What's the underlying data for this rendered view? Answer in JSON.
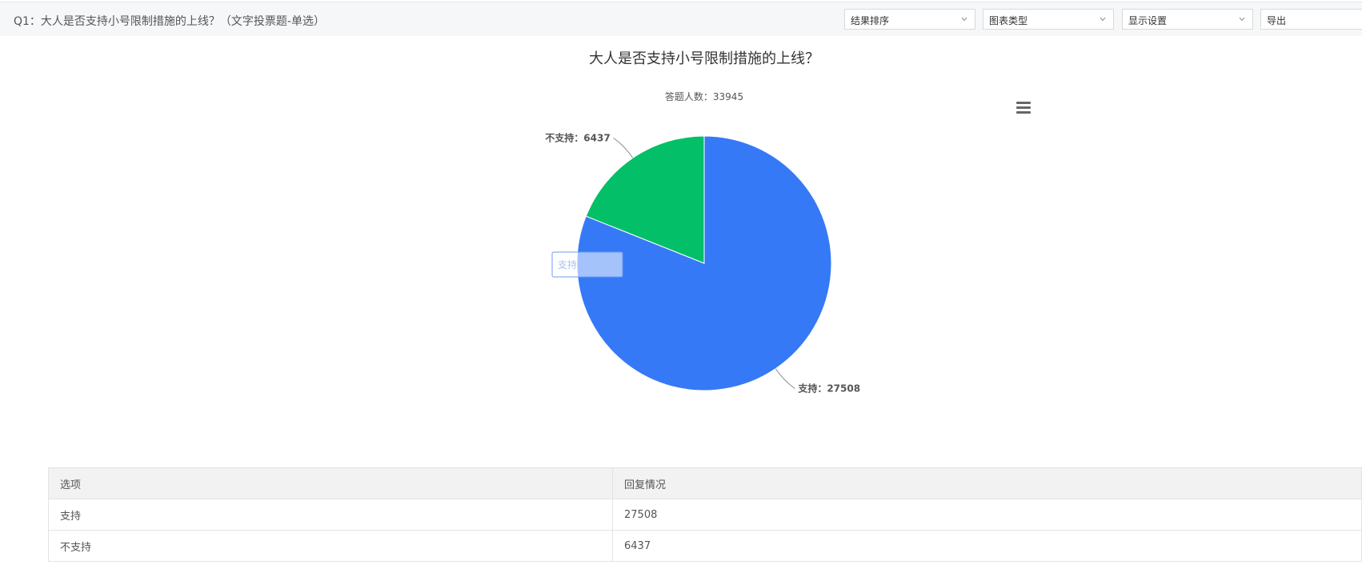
{
  "header": {
    "question_title": "Q1：大人是否支持小号限制措施的上线？（文字投票题-单选）",
    "controls": [
      {
        "label": "结果排序"
      },
      {
        "label": "图表类型"
      },
      {
        "label": "显示设置"
      },
      {
        "label": "导出"
      }
    ]
  },
  "chart_data": {
    "type": "pie",
    "title": "大人是否支持小号限制措施的上线？",
    "subtitle": "答题人数：33945",
    "slices": [
      {
        "label": "支持",
        "value": 27508,
        "color": "#3579f6",
        "display": "支持：27508"
      },
      {
        "label": "不支持",
        "value": 6437,
        "color": "#03bf67",
        "display": "不支持：6437"
      }
    ],
    "tooltip": {
      "text": "支持：27508"
    }
  },
  "table": {
    "headers": [
      "选项",
      "回复情况"
    ],
    "rows": [
      [
        "支持",
        "27508"
      ],
      [
        "不支持",
        "6437"
      ]
    ]
  }
}
